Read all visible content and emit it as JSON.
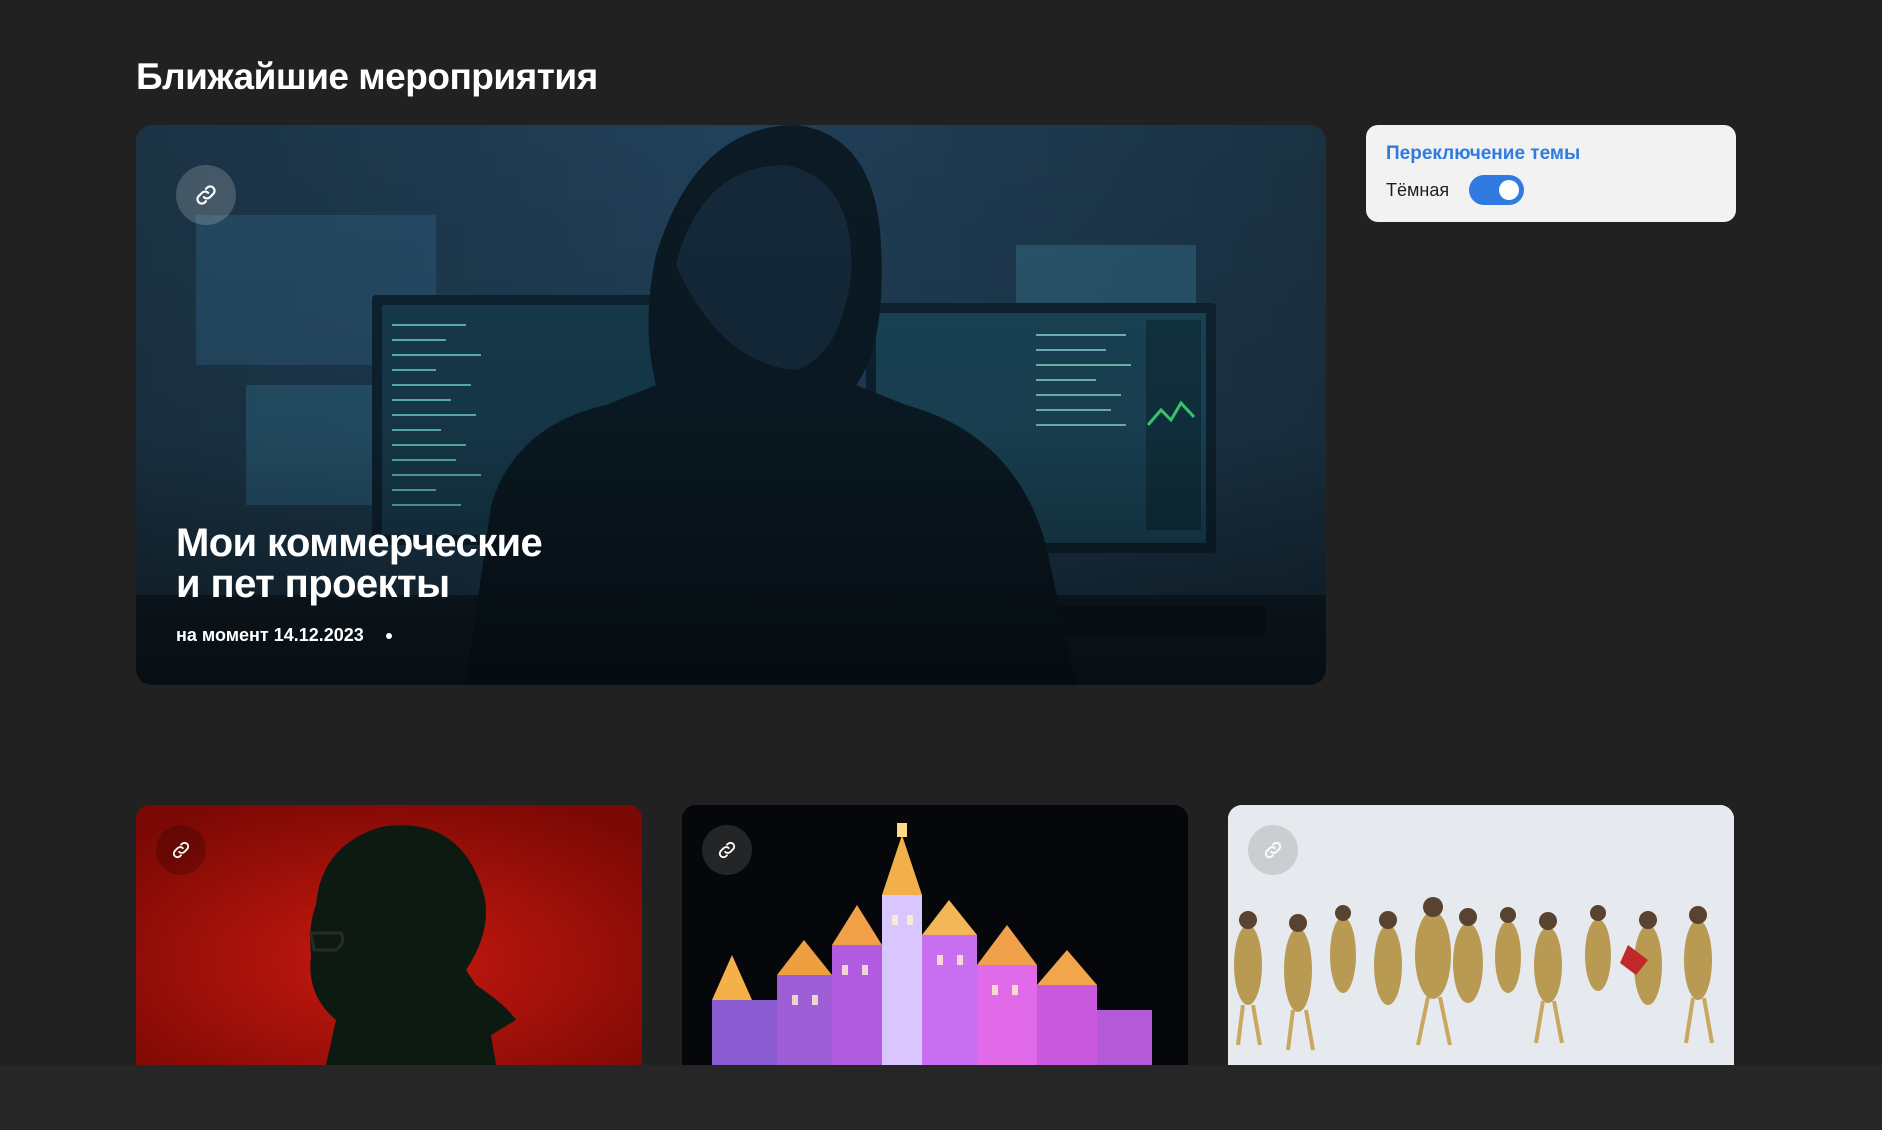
{
  "section": {
    "title": "Ближайшие мероприятия"
  },
  "featured": {
    "title_line1": "Мои коммерческие",
    "title_line2": "и пет проекты",
    "date": "на момент 14.12.2023",
    "link_icon": "link-icon"
  },
  "theme_switcher": {
    "title": "Переключение темы",
    "label": "Тёмная",
    "enabled": true,
    "accent_color": "#2f7be0"
  },
  "cards": [
    {
      "name": "event-card-portrait",
      "link_icon": "link-icon",
      "background": "#a60f08"
    },
    {
      "name": "event-card-castle",
      "link_icon": "link-icon",
      "background": "#050608"
    },
    {
      "name": "event-card-dancers",
      "link_icon": "link-icon",
      "background": "#e4e8ec"
    }
  ],
  "colors": {
    "page_background": "#212121",
    "text": "#ffffff"
  }
}
